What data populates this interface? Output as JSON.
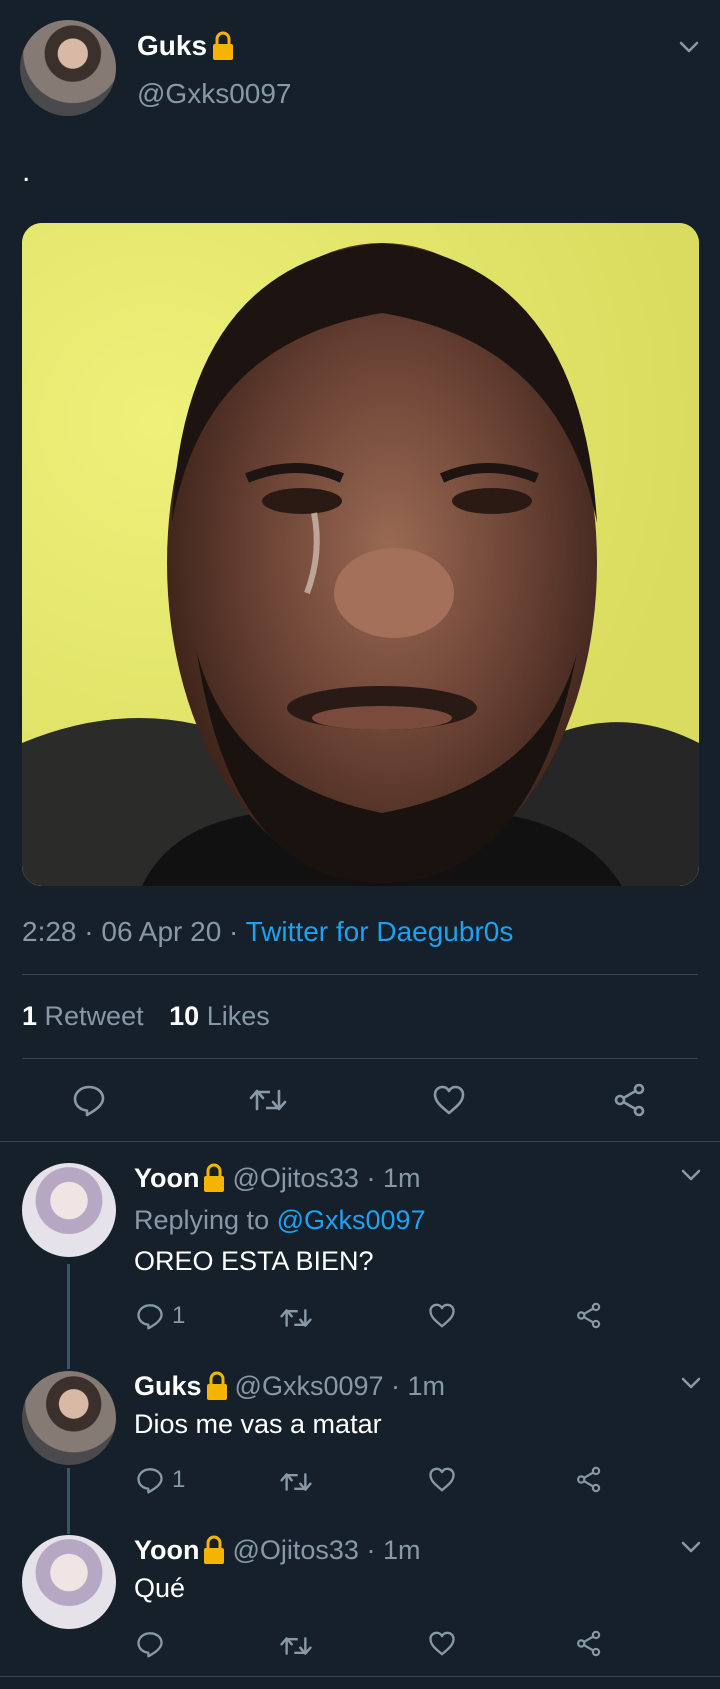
{
  "tweet": {
    "name": "Guks",
    "handle": "@Gxks0097",
    "text": ".",
    "time": "2:28",
    "date": "06 Apr 20",
    "source": "Twitter for Daegubr0s",
    "retweet_count": "1",
    "retweet_label": "Retweet",
    "like_count": "10",
    "like_label": "Likes"
  },
  "replies": [
    {
      "name": "Yoon",
      "handle": "@Ojitos33",
      "time": "1m",
      "replying_prefix": "Replying to",
      "replying_to": "@Gxks0097",
      "text": "OREO ESTA BIEN?",
      "reply_count": "1"
    },
    {
      "name": "Guks",
      "handle": "@Gxks0097",
      "time": "1m",
      "text": "Dios me vas a matar",
      "reply_count": "1"
    },
    {
      "name": "Yoon",
      "handle": "@Ojitos33",
      "time": "1m",
      "text": "Qué"
    }
  ],
  "colors": {
    "background": "#15202b",
    "accent": "#1da1f2",
    "secondary_text": "#8899a6",
    "lock": "#f5b400"
  },
  "icons": [
    "lock-icon",
    "chevron-down-icon",
    "reply-icon",
    "retweet-icon",
    "like-icon",
    "share-icon"
  ]
}
